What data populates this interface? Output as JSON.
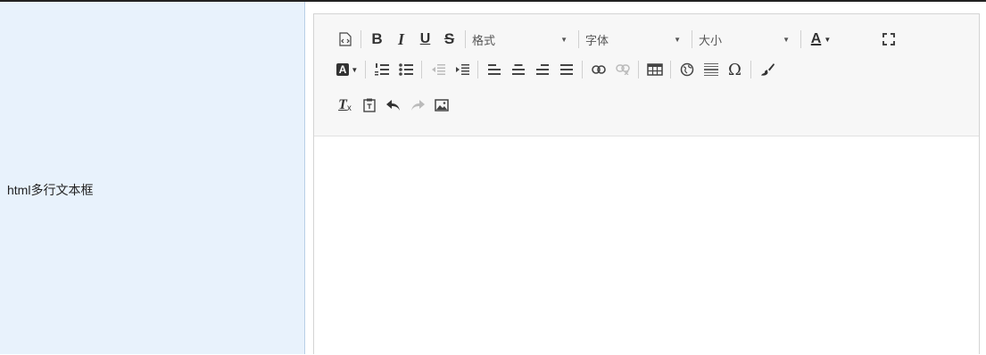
{
  "field": {
    "label": "html多行文本框"
  },
  "editor": {
    "toolbar": {
      "format_combo": {
        "value": "格式"
      },
      "font_combo": {
        "value": "字体"
      },
      "size_combo": {
        "value": "大小"
      },
      "text_color_letter": "A",
      "bg_color_letter": "A",
      "bold_glyph": "B",
      "italic_glyph": "I",
      "underline_glyph": "U",
      "strike_glyph": "S",
      "special_char_glyph": "Ω",
      "remove_format_glyph": "T"
    },
    "content": ""
  }
}
